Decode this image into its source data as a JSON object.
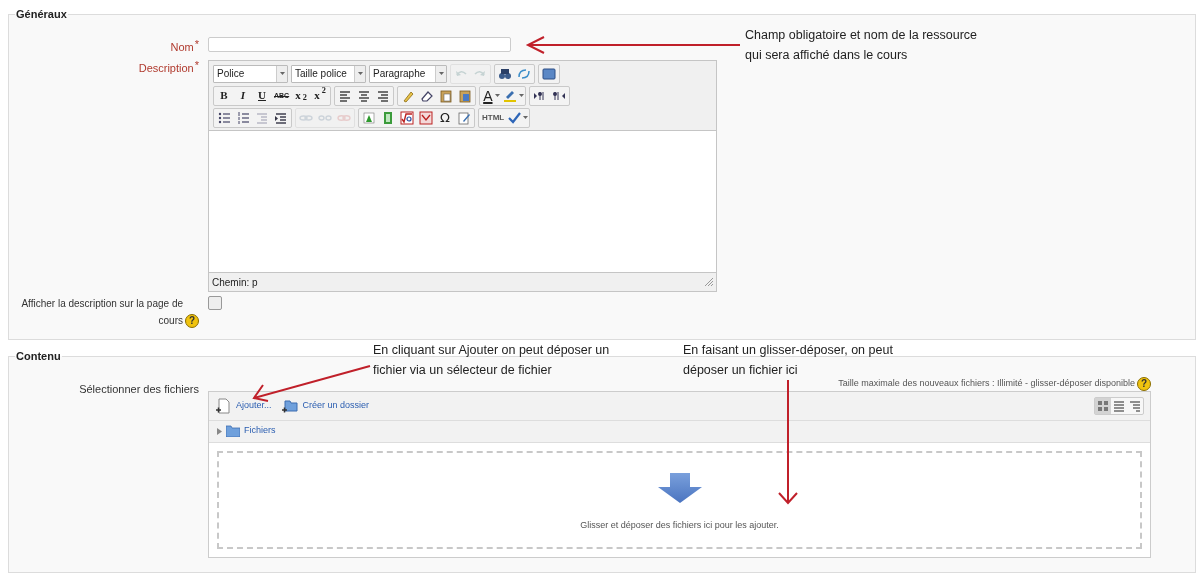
{
  "general": {
    "legend": "Généraux",
    "name_field": {
      "label": "Nom",
      "required_mark": "*"
    },
    "description": {
      "label": "Description",
      "required_mark": "*",
      "toolbar_rows": [
        [
          {
            "selects": [
              "Police",
              "Taille police",
              "Paragraphe"
            ]
          },
          {
            "disabled": true,
            "items": [
              {
                "kind": "undo"
              },
              {
                "kind": "redo"
              }
            ]
          },
          {
            "disabled": false,
            "items": [
              {
                "kind": "find"
              },
              {
                "kind": "replace"
              }
            ]
          },
          {
            "disabled": false,
            "items": [
              {
                "kind": "fullscreen"
              }
            ]
          }
        ],
        [
          {
            "disabled": false,
            "items": [
              {
                "kind": "bold",
                "label": "B"
              },
              {
                "kind": "italic",
                "label": "I"
              },
              {
                "kind": "underline",
                "label": "U"
              },
              {
                "kind": "strike",
                "label": "ABC"
              },
              {
                "kind": "subscript",
                "label": "x$_{2}$"
              },
              {
                "kind": "superscript",
                "label": "x$^{2}$"
              }
            ]
          },
          {
            "disabled": false,
            "items": [
              {
                "kind": "align_left"
              },
              {
                "kind": "align_center"
              },
              {
                "kind": "align_right"
              }
            ]
          },
          {
            "disabled": false,
            "items": [
              {
                "kind": "cleanup"
              },
              {
                "kind": "eraser"
              },
              {
                "kind": "paste_text"
              },
              {
                "kind": "paste_word"
              }
            ]
          },
          {
            "disabled": false,
            "items": [
              {
                "kind": "font_color",
                "label": "A"
              },
              {
                "kind": "highlight"
              }
            ]
          },
          {
            "disabled": false,
            "items": [
              {
                "kind": "ltr"
              },
              {
                "kind": "rtl"
              }
            ]
          }
        ],
        [
          {
            "disabled": false,
            "items": [
              {
                "kind": "bullets"
              },
              {
                "kind": "numbers"
              },
              {
                "kind": "outdent"
              },
              {
                "kind": "indent"
              }
            ]
          },
          {
            "disabled": true,
            "items": [
              {
                "kind": "link"
              },
              {
                "kind": "unlink"
              },
              {
                "kind": "anchor"
              }
            ]
          },
          {
            "disabled": false,
            "items": [
              {
                "kind": "image"
              },
              {
                "kind": "media"
              },
              {
                "kind": "equation"
              },
              {
                "kind": "tex"
              },
              {
                "kind": "symbol",
                "label": "Ω"
              },
              {
                "kind": "template"
              }
            ]
          },
          {
            "disabled": false,
            "items": [
              {
                "kind": "html",
                "label": "HTML"
              },
              {
                "kind": "spellcheck"
              }
            ]
          }
        ]
      ],
      "path": "Chemin: p"
    },
    "show_description": {
      "label": "Afficher la description sur la page de cours",
      "help": "?",
      "checked": false
    }
  },
  "content": {
    "legend": "Contenu",
    "files_label": "Sélectionner des fichiers",
    "max_size": "Taille maximale des nouveaux fichiers : Illimité - glisser-déposer disponible",
    "max_size_help": "?",
    "actions": [
      "Ajouter...",
      "Créer un dossier"
    ],
    "view_modes": [
      {
        "selected": true
      },
      {
        "selected": false
      },
      {
        "selected": false
      }
    ],
    "folder": "Fichiers",
    "drop_hint": "Glisser et déposer des fichiers ici pour les ajouter."
  },
  "annotations": [
    {
      "text": "Champ obligatoire et nom de la ressource qui sera affiché dans le cours"
    },
    {
      "text": "En cliquant sur Ajouter on peut déposer un fichier via un sélecteur de fichier"
    },
    {
      "text": "En faisant un glisser-déposer, on peut déposer un fichier ici"
    }
  ]
}
